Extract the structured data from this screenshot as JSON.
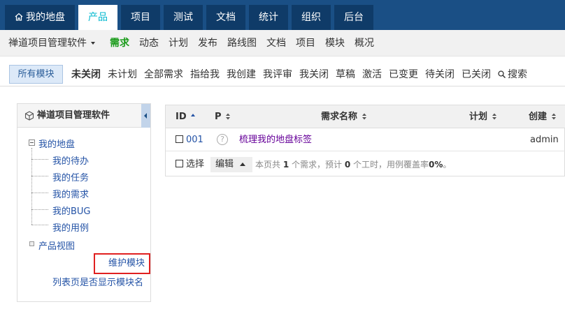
{
  "topnav": {
    "tabs": [
      {
        "label": "我的地盘"
      },
      {
        "label": "产品"
      },
      {
        "label": "项目"
      },
      {
        "label": "测试"
      },
      {
        "label": "文档"
      },
      {
        "label": "统计"
      },
      {
        "label": "组织"
      },
      {
        "label": "后台"
      }
    ]
  },
  "subnav": {
    "product": "禅道项目管理软件",
    "items": [
      {
        "label": "需求"
      },
      {
        "label": "动态"
      },
      {
        "label": "计划"
      },
      {
        "label": "发布"
      },
      {
        "label": "路线图"
      },
      {
        "label": "文档"
      },
      {
        "label": "项目"
      },
      {
        "label": "模块"
      },
      {
        "label": "概况"
      }
    ]
  },
  "featurebar": {
    "module_label": "所有模块",
    "filters": [
      {
        "label": "未关闭"
      },
      {
        "label": "未计划"
      },
      {
        "label": "全部需求"
      },
      {
        "label": "指给我"
      },
      {
        "label": "我创建"
      },
      {
        "label": "我评审"
      },
      {
        "label": "我关闭"
      },
      {
        "label": "草稿"
      },
      {
        "label": "激活"
      },
      {
        "label": "已变更"
      },
      {
        "label": "待关闭"
      },
      {
        "label": "已关闭"
      }
    ],
    "search_label": "搜索"
  },
  "side": {
    "title": "禅道项目管理软件",
    "tree": {
      "root": "我的地盘",
      "children": [
        "我的待办",
        "我的任务",
        "我的需求",
        "我的BUG",
        "我的用例"
      ],
      "other": "产品视图"
    },
    "maintain_label": "维护模块",
    "show_module_label": "列表页是否显示模块名"
  },
  "table": {
    "headers": {
      "id": "ID",
      "pri": "P",
      "name": "需求名称",
      "plan": "计划",
      "creator": "创建"
    },
    "rows": [
      {
        "id": "001",
        "pri_icon": "?",
        "name": "梳理我的地盘标签",
        "plan": "",
        "creator": "admin"
      }
    ],
    "footer": {
      "select_label": "选择",
      "edit_label": "编辑",
      "summary_pre": "本页共 ",
      "summary_count": "1",
      "summary_mid": " 个需求，预计 ",
      "summary_hours": "0",
      "summary_mid2": " 个工时，用例覆盖率",
      "summary_rate": "0%",
      "summary_end": "。"
    }
  },
  "colors": {
    "topnav_bg": "#1a4f85",
    "tab_bg": "#0f3b68",
    "active_tab_text": "#03b8cf",
    "active_subnav": "#1a9b1a",
    "highlight_border": "#e02020"
  }
}
